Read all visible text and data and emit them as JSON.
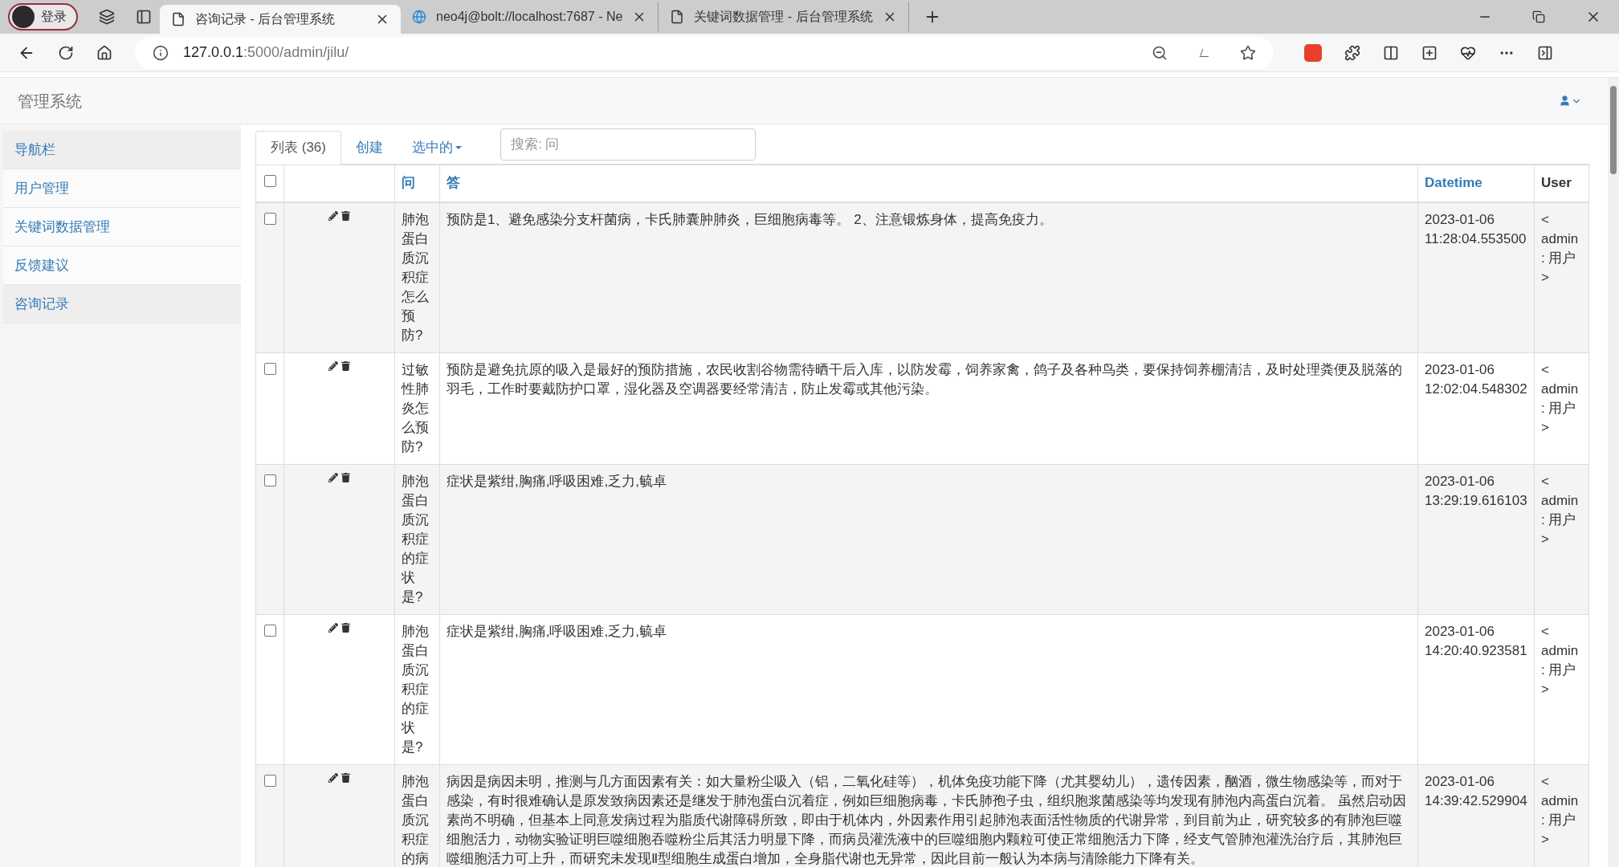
{
  "browser": {
    "profile": "登录",
    "tabs": [
      {
        "title": "咨询记录 - 后台管理系统",
        "selected": true,
        "kind": "page"
      },
      {
        "title": "neo4j@bolt://localhost:7687 - Ne",
        "selected": false,
        "kind": "globe"
      },
      {
        "title": "关键词数据管理 - 后台管理系统",
        "selected": false,
        "kind": "page"
      }
    ],
    "url_host": "127.0.0.1",
    "url_path": ":5000/admin/jilu/"
  },
  "brand": "管理系统",
  "sidebar": {
    "items": [
      {
        "label": "导航栏",
        "kind": "header"
      },
      {
        "label": "用户管理",
        "kind": "link",
        "selected": false
      },
      {
        "label": "关键词数据管理",
        "kind": "link",
        "selected": false
      },
      {
        "label": "反馈建议",
        "kind": "link",
        "selected": false
      },
      {
        "label": "咨询记录",
        "kind": "link",
        "selected": true
      }
    ]
  },
  "list_tabs": [
    {
      "label": "列表 (36)",
      "kind": "tab",
      "selected": true
    },
    {
      "label": "创建",
      "kind": "tab",
      "selected": false
    },
    {
      "label": "选中的",
      "kind": "dropdown",
      "selected": false
    }
  ],
  "search": {
    "placeholder": "搜索: 问"
  },
  "table": {
    "select_all": {
      "checked": false
    },
    "columns": [
      {
        "label": "问",
        "sortable": true
      },
      {
        "label": "答",
        "sortable": true
      },
      {
        "label": "Datetime",
        "sortable": true
      },
      {
        "label": "User",
        "sortable": false
      }
    ],
    "rows": [
      {
        "checked": false,
        "question": "肺泡蛋白质沉积症怎么预防?",
        "answer": "预防是1、避免感染分支杆菌病，卡氏肺囊肿肺炎，巨细胞病毒等。 2、注意锻炼身体，提高免疫力。",
        "datetime": "2023-01-06 11:28:04.553500",
        "user": "< admin : 用户 >"
      },
      {
        "checked": false,
        "question": "过敏性肺炎怎么预防?",
        "answer": "预防是避免抗原的吸入是最好的预防措施，农民收割谷物需待晒干后入库，以防发霉，饲养家禽，鸽子及各种鸟类，要保持饲养棚清洁，及时处理粪便及脱落的羽毛，工作时要戴防护口罩，湿化器及空调器要经常清洁，防止发霉或其他污染。",
        "datetime": "2023-01-06 12:02:04.548302",
        "user": "< admin : 用户 >"
      },
      {
        "checked": false,
        "question": "肺泡蛋白质沉积症的症状是?",
        "answer": "症状是紫绀,胸痛,呼吸困难,乏力,毓卓",
        "datetime": "2023-01-06 13:29:19.616103",
        "user": "< admin : 用户 >"
      },
      {
        "checked": false,
        "question": "肺泡蛋白质沉积症的症状是?",
        "answer": "症状是紫绀,胸痛,呼吸困难,乏力,毓卓",
        "datetime": "2023-01-06 14:20:40.923581",
        "user": "< admin : 用户 >"
      },
      {
        "checked": false,
        "question": "肺泡蛋白质沉积症的病",
        "answer": "病因是病因未明，推测与几方面因素有关：如大量粉尘吸入（铝，二氧化硅等），机体免疫功能下降（尤其婴幼儿），遗传因素，酗酒，微生物感染等，而对于感染，有时很难确认是原发致病因素还是继发于肺泡蛋白沉着症，例如巨细胞病毒，卡氏肺孢子虫，组织胞浆菌感染等均发现有肺泡内高蛋白沉着。 虽然启动因素尚不明确，但基本上同意发病过程为脂质代谢障碍所致，即由于机体内，外因素作用引起肺泡表面活性物质的代谢异常，到目前为止，研究较多的有肺泡巨噬细胞活力，动物实验证明巨噬细胞吞噬粉尘后其活力明显下降，而病员灌洗液中的巨噬细胞内颗粒可使正常细胞活力下降，经支气管肺泡灌洗治疗后，其肺泡巨噬细胞活力可上升，而研究未发现Ⅱ型细胞生成蛋白增加，全身脂代谢也无异常，因此目前一般认为本病与清除能力下降有关。",
        "datetime": "2023-01-06 14:39:42.529904",
        "user": "< admin : 用户 >"
      }
    ]
  }
}
